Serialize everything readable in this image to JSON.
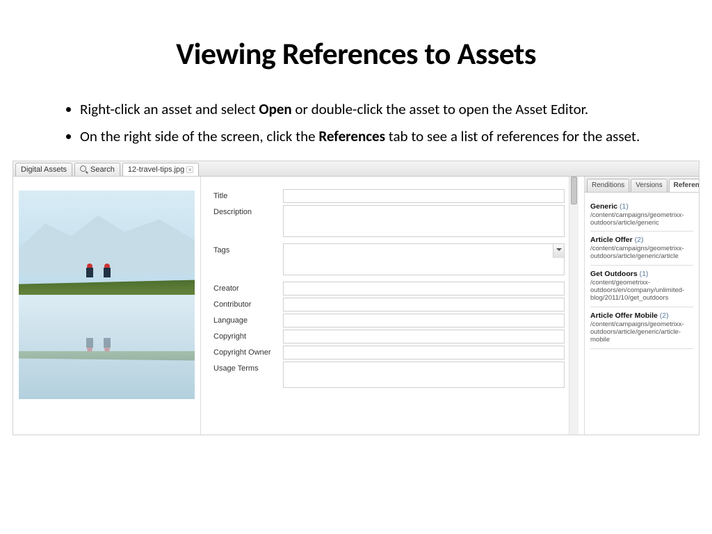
{
  "title": "Viewing References to Assets",
  "bullets": [
    {
      "pre": "Right-click an asset and select ",
      "bold": "Open",
      "post": " or double-click the asset to open the Asset Editor."
    },
    {
      "pre": "On the right side of the screen, click the ",
      "bold": "References",
      "post": " tab to see a list of references for the asset."
    }
  ],
  "tabs": {
    "digital_assets": "Digital Assets",
    "search": "Search",
    "file": "12-travel-tips.jpg"
  },
  "form": {
    "title": "Title",
    "description": "Description",
    "tags": "Tags",
    "creator": "Creator",
    "contributor": "Contributor",
    "language": "Language",
    "copyright": "Copyright",
    "copyright_owner": "Copyright Owner",
    "usage_terms": "Usage Terms"
  },
  "right_tabs": {
    "renditions": "Renditions",
    "versions": "Versions",
    "references": "References"
  },
  "refs": [
    {
      "name": "Generic",
      "count": "(1)",
      "path": "/content/campaigns/geometrixx-outdoors/article/generic"
    },
    {
      "name": "Article Offer",
      "count": "(2)",
      "path": "/content/campaigns/geometrixx-outdoors/article/generic/article"
    },
    {
      "name": "Get Outdoors",
      "count": "(1)",
      "path": "/content/geometrixx-outdoors/en/company/unlimited-blog/2011/10/get_outdoors"
    },
    {
      "name": "Article Offer Mobile",
      "count": "(2)",
      "path": "/content/campaigns/geometrixx-outdoors/article/generic/article-mobile"
    }
  ]
}
